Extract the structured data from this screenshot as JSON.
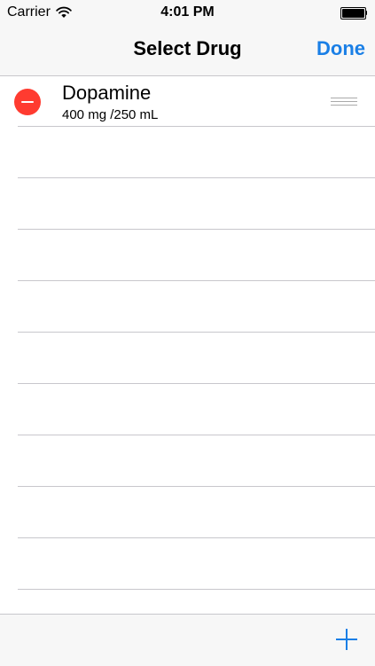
{
  "status_bar": {
    "carrier": "Carrier",
    "time": "4:01 PM",
    "icons": [
      "wifi-icon",
      "battery-icon"
    ]
  },
  "nav": {
    "title": "Select Drug",
    "done_label": "Done"
  },
  "drugs": [
    {
      "name": "Dopamine",
      "concentration": "400 mg /250 mL"
    }
  ],
  "toolbar": {
    "add_icon": "plus-icon"
  },
  "colors": {
    "accent": "#1a7fe6",
    "delete": "#ff3b30",
    "bar_background": "#f7f7f7",
    "separator": "#c8c7cc"
  }
}
